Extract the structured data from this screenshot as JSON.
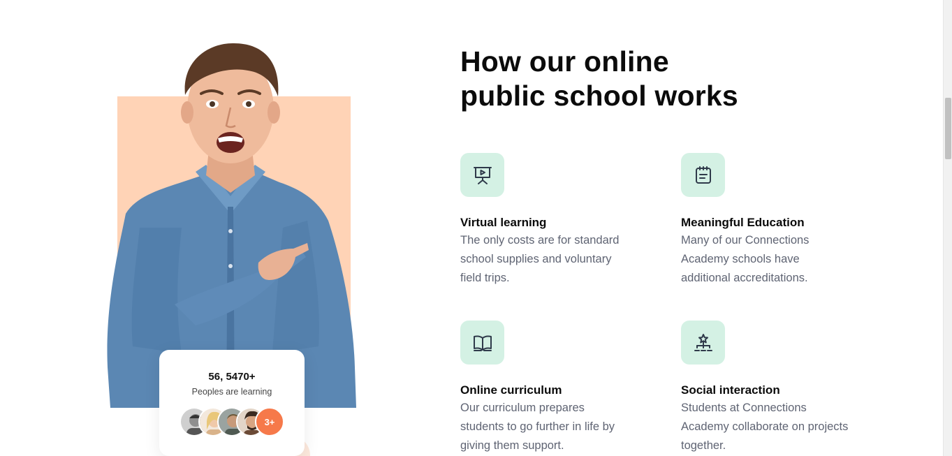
{
  "section": {
    "title_line1": "How our online",
    "title_line2": "public school works"
  },
  "stats_card": {
    "number": "56, 5470+",
    "label": "Peoples are learning",
    "more_badge": "3+"
  },
  "features": [
    {
      "icon": "presentation-board-icon",
      "title": "Virtual learning",
      "description": "The only costs are for standard school supplies and voluntary field trips."
    },
    {
      "icon": "notepad-icon",
      "title": "Meaningful Education",
      "description": "Many of our Connections Academy schools have additional accreditations."
    },
    {
      "icon": "open-book-icon",
      "title": "Online curriculum",
      "description": "Our curriculum prepares students to go further in life by giving them support."
    },
    {
      "icon": "star-network-icon",
      "title": "Social interaction",
      "description": "Students at Connections Academy collaborate on projects together."
    }
  ],
  "colors": {
    "peach": "#ffd3b6",
    "mint": "#d4f1e4",
    "accent_orange": "#f6794a",
    "body_text": "#5f6473",
    "icon_stroke": "#2f3a4a"
  }
}
